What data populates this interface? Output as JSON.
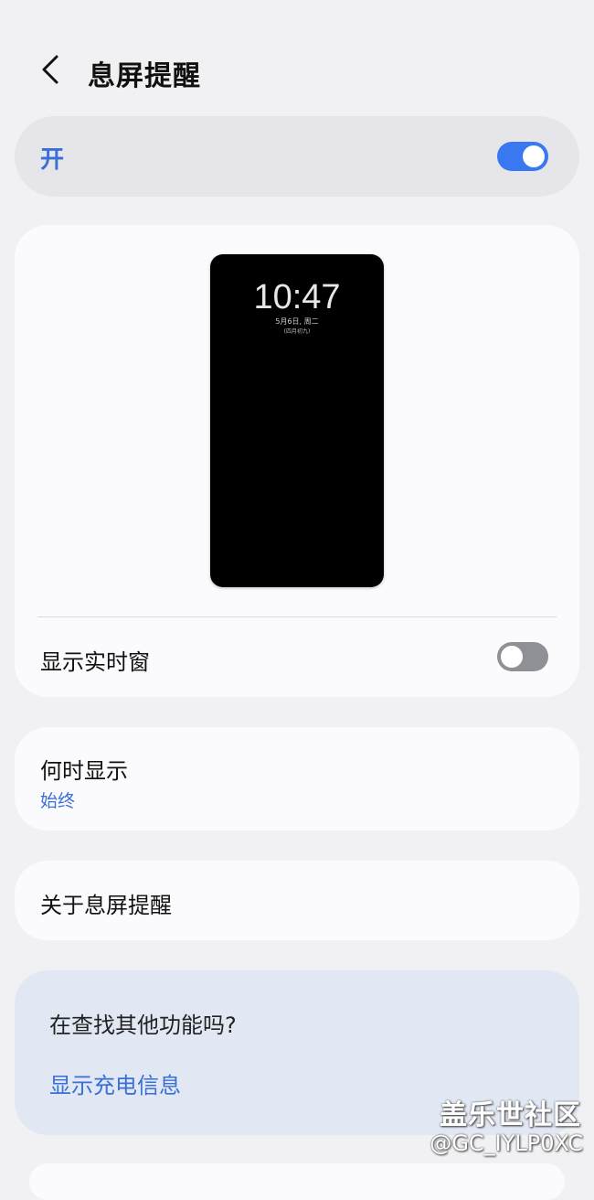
{
  "header": {
    "title": "息屏提醒",
    "back_icon": "chevron-left-icon"
  },
  "master_switch": {
    "label": "开",
    "state": "on",
    "accent_color": "#3a78f2"
  },
  "preview": {
    "time": "10:47",
    "date": "5月6日, 周二",
    "lunar": "(四月初九)"
  },
  "live_window": {
    "label": "显示实时窗",
    "state": "off"
  },
  "when_to_show": {
    "label": "何时显示",
    "value": "始终"
  },
  "about": {
    "label": "关于息屏提醒"
  },
  "suggestions": {
    "title": "在查找其他功能吗?",
    "link": "显示充电信息"
  },
  "watermark": {
    "line1": "盖乐世社区",
    "line2": "@GC_IYLP0XC"
  }
}
